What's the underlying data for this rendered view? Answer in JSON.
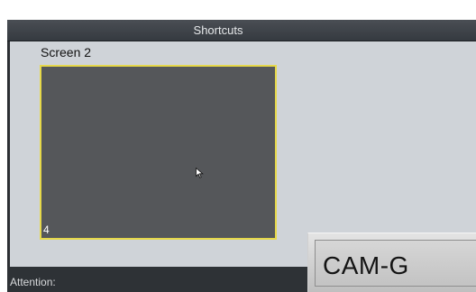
{
  "window": {
    "title": "Shortcuts"
  },
  "screen": {
    "label": "Screen 2",
    "tile_number": "4"
  },
  "footer": {
    "attention_label": "Attention:"
  },
  "overlay": {
    "camera_name": "CAM-G"
  },
  "icons": {
    "cursor": "mouse-pointer-icon"
  },
  "colors": {
    "tile_border": "#e6d84a",
    "tile_fill": "#55575a",
    "panel_bg": "#cfd3d8",
    "frame_bg": "#2c2f33"
  }
}
